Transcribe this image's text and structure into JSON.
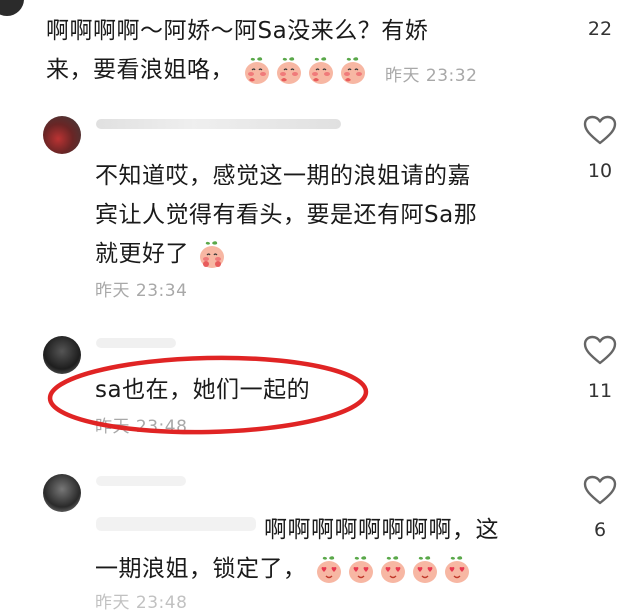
{
  "comments": [
    {
      "text_line1": "啊啊啊啊～阿娇～阿Sa没来么？有娇",
      "text_line2": "来，要看浪姐咯，",
      "time": "昨天 23:32",
      "likes": "22",
      "emoji_count": 4,
      "emoji_name": "blushing-peach-emoji"
    },
    {
      "text_line1": "不知道哎，感觉这一期的浪姐请的嘉",
      "text_line2": "宾让人觉得有看头，要是还有阿Sa那",
      "text_line3": "就更好了",
      "time": "昨天 23:34",
      "likes": "10",
      "emoji_name": "shy-peach-emoji"
    },
    {
      "text": "sa也在，她们一起的",
      "time": "昨天 23:48",
      "likes": "11",
      "annotation_color": "#e02424"
    },
    {
      "text_line1": "啊啊啊啊啊啊啊啊，这",
      "text_line2": "一期浪姐，锁定了，",
      "time": "昨天 23:48",
      "likes": "6",
      "emoji_count": 5,
      "emoji_name": "heart-eyes-peach-emoji"
    }
  ],
  "icons": {
    "like": "heart-outline-icon"
  },
  "colors": {
    "meta": "#a8a8a8",
    "heart_stroke": "#666666",
    "circle": "#e02424"
  }
}
